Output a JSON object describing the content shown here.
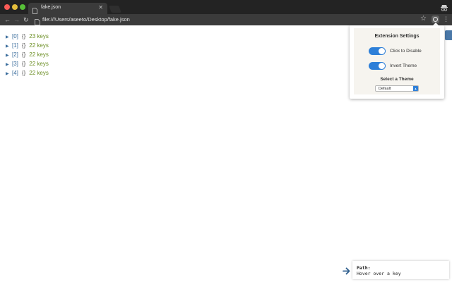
{
  "browser": {
    "tab_title": "fake.json",
    "tab_close": "✕",
    "url": "file:///Users/aseeto/Desktop/fake.json"
  },
  "toolbar": {
    "back": "←",
    "forward": "→",
    "reload": "↻",
    "star": "☆",
    "menu": "⋮"
  },
  "json_tree": {
    "arrow": "▶",
    "brace": "{}",
    "rows": [
      {
        "index": "[0]",
        "count": "23 keys"
      },
      {
        "index": "[1]",
        "count": "22 keys"
      },
      {
        "index": "[2]",
        "count": "22 keys"
      },
      {
        "index": "[3]",
        "count": "22 keys"
      },
      {
        "index": "[4]",
        "count": "22 keys"
      }
    ]
  },
  "popup": {
    "title": "Extension Settings",
    "toggle_disable": {
      "label": "Click to Disable",
      "on": true
    },
    "toggle_invert": {
      "label": "Invert Theme",
      "on": true
    },
    "theme_heading": "Select a Theme",
    "theme_value": "Default",
    "accent_color": "#2d7fd8"
  },
  "path_panel": {
    "label": "Path:",
    "value": "Hover over a key"
  }
}
